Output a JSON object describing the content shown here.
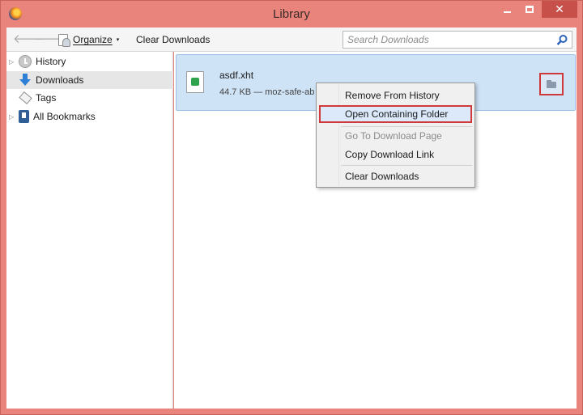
{
  "window": {
    "title": "Library",
    "close_glyph": "✕"
  },
  "toolbar": {
    "back_glyph": "🡐",
    "forward_glyph": "🡒",
    "organize_label": "Organize",
    "organize_caret": "▾",
    "clear_downloads_label": "Clear Downloads",
    "search_placeholder": "Search Downloads"
  },
  "sidebar": {
    "items": [
      {
        "label": "History",
        "icon": "history-icon",
        "expandable": true
      },
      {
        "label": "Downloads",
        "icon": "download-icon",
        "expandable": false,
        "selected": true
      },
      {
        "label": "Tags",
        "icon": "tag-icon",
        "expandable": false
      },
      {
        "label": "All Bookmarks",
        "icon": "bookmarks-icon",
        "expandable": true
      }
    ],
    "twisty_glyph": "▷"
  },
  "download": {
    "file_name": "asdf.xht",
    "meta": "44.7 KB — moz-safe-ab"
  },
  "context_menu": {
    "items": [
      {
        "label": "Remove From History",
        "enabled": true
      },
      {
        "label": "Open Containing Folder",
        "enabled": true,
        "highlighted": true
      },
      {
        "label": "Go To Download Page",
        "enabled": false
      },
      {
        "label": "Copy Download Link",
        "enabled": true
      },
      {
        "label": "Clear Downloads",
        "enabled": true
      }
    ]
  },
  "colors": {
    "frame": "#e8847b",
    "selection": "#cfe3f7",
    "annotation": "#d0393b"
  }
}
